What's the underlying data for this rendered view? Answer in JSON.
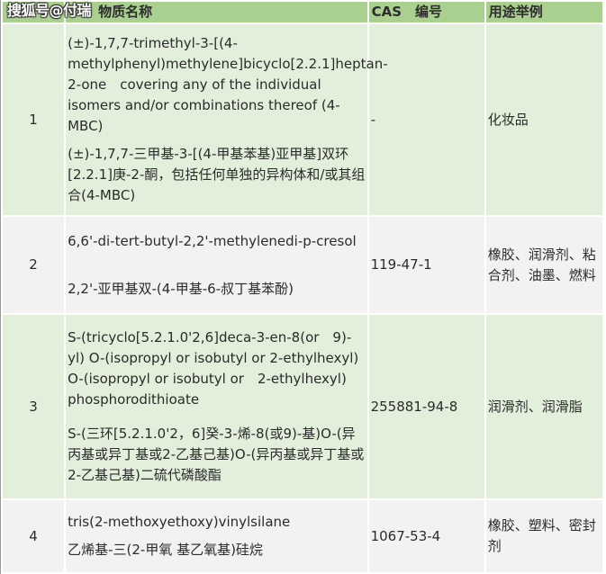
{
  "watermark": "搜狐号@付瑞",
  "table": {
    "headers": {
      "number": "",
      "name": "物质名称",
      "cas": "CAS　编号",
      "use": "用途举例"
    },
    "rows": [
      {
        "number": "1",
        "name_en": "(±)-1,7,7-trimethyl-3-[(4-methylphenyl)methylene]bicyclo[2.2.1]heptan-2-one　covering any of the individual isomers and/or combinations thereof (4-MBC)",
        "name_cn": "(±)-1,7,7-三甲基-3-[(4-甲基苯基)亚甲基]双环[2.2.1]庚-2-酮，包括任何单独的异构体和/或其组合(4-MBC)",
        "cas": "-",
        "use": "化妆品"
      },
      {
        "number": "2",
        "name_en": "6,6'-di-tert-butyl-2,2'-methylenedi-p-cresol",
        "name_cn": "2,2'-亚甲基双-(4-甲基-6-叔丁基苯酚)",
        "cas": "119-47-1",
        "use": "橡胶、润滑剂、粘合剂、油墨、燃料"
      },
      {
        "number": "3",
        "name_en": "S-(tricyclo[5.2.1.0'2,6]deca-3-en-8(or　9)-yl) O-(isopropyl or isobutyl or 2-ethylhexyl) O-(isopropyl or isobutyl or　2-ethylhexyl) phosphorodithioate",
        "name_cn": "S-(三环[5.2.1.0'2，6]癸-3-烯-8(或9)-基)O-(异丙基或异丁基或2-乙基己基)O-(异丙基或异丁基或2-乙基己基)二硫代磷酸酯",
        "cas": "255881-94-8",
        "use": "润滑剂、润滑脂"
      },
      {
        "number": "4",
        "name_en": "tris(2-methoxyethoxy)vinylsilane",
        "name_cn": "乙烯基-三(2-甲氧 基乙氧基)硅烷",
        "cas": "1067-53-4",
        "use": "橡胶、塑料、密封剂"
      }
    ]
  },
  "colors": {
    "header_bg": "#a9d08e",
    "row_green_bg": "#e2efda",
    "row_gray_bg": "#f2f2f2"
  }
}
